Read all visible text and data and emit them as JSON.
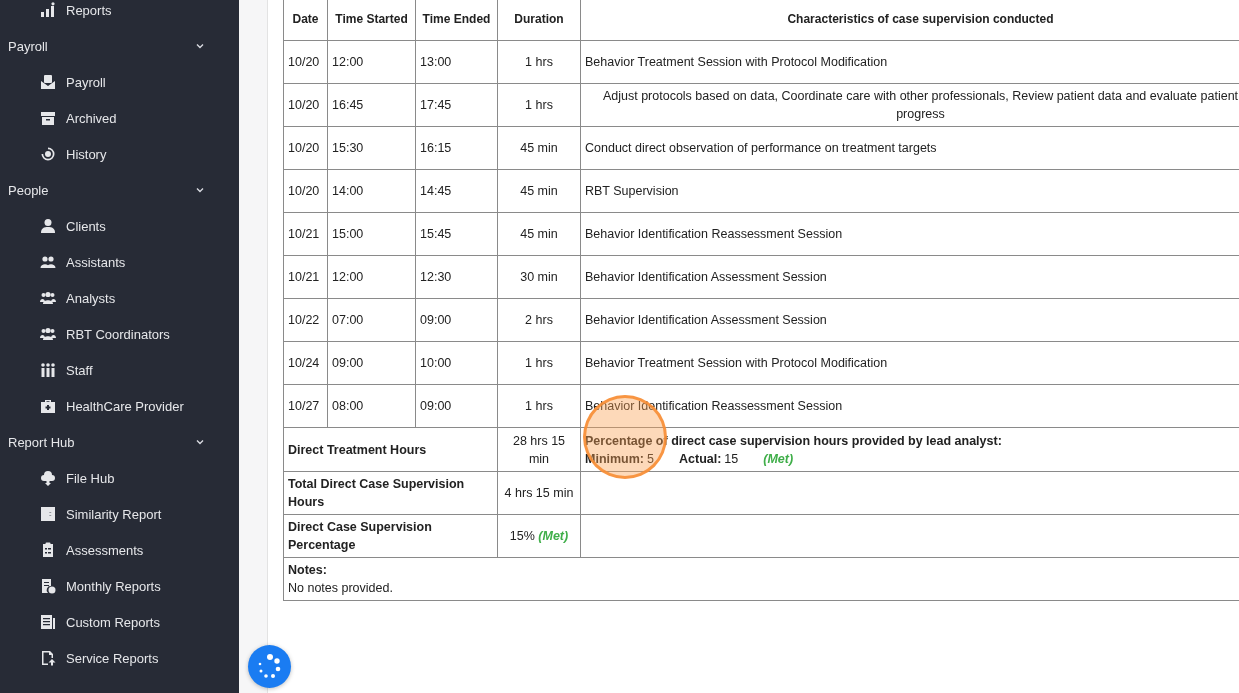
{
  "sidebar": {
    "sections": [
      {
        "items": [
          {
            "label": "Reports"
          }
        ]
      },
      {
        "title": "Payroll",
        "expanded": true,
        "items": [
          {
            "label": "Payroll"
          },
          {
            "label": "Archived"
          },
          {
            "label": "History"
          }
        ]
      },
      {
        "title": "People",
        "expanded": true,
        "items": [
          {
            "label": "Clients"
          },
          {
            "label": "Assistants"
          },
          {
            "label": "Analysts"
          },
          {
            "label": "RBT Coordinators"
          },
          {
            "label": "Staff"
          },
          {
            "label": "HealthCare Provider"
          }
        ]
      },
      {
        "title": "Report Hub",
        "expanded": true,
        "items": [
          {
            "label": "File Hub"
          },
          {
            "label": "Similarity Report"
          },
          {
            "label": "Assessments"
          },
          {
            "label": "Monthly Reports"
          },
          {
            "label": "Custom Reports"
          },
          {
            "label": "Service Reports"
          }
        ]
      }
    ]
  },
  "table": {
    "columns": [
      "Date",
      "Time Started",
      "Time Ended",
      "Duration",
      "Characteristics of case supervision conducted"
    ],
    "rows": [
      {
        "date": "10/20",
        "started": "12:00",
        "ended": "13:00",
        "duration": "1 hrs",
        "characteristics": "Behavior Treatment Session with Protocol Modification",
        "centered": false
      },
      {
        "date": "10/20",
        "started": "16:45",
        "ended": "17:45",
        "duration": "1 hrs",
        "characteristics": "Adjust protocols based on data, Coordinate care with other professionals, Review patient data and evaluate patient progress",
        "centered": true
      },
      {
        "date": "10/20",
        "started": "15:30",
        "ended": "16:15",
        "duration": "45 min",
        "characteristics": "Conduct direct observation of performance on treatment targets",
        "centered": false
      },
      {
        "date": "10/20",
        "started": "14:00",
        "ended": "14:45",
        "duration": "45 min",
        "characteristics": "RBT Supervision",
        "centered": false
      },
      {
        "date": "10/21",
        "started": "15:00",
        "ended": "15:45",
        "duration": "45 min",
        "characteristics": "Behavior Identification Reassessment Session",
        "centered": false
      },
      {
        "date": "10/21",
        "started": "12:00",
        "ended": "12:30",
        "duration": "30 min",
        "characteristics": "Behavior Identification Assessment Session",
        "centered": false
      },
      {
        "date": "10/22",
        "started": "07:00",
        "ended": "09:00",
        "duration": "2 hrs",
        "characteristics": "Behavior Identification Assessment Session",
        "centered": false
      },
      {
        "date": "10/24",
        "started": "09:00",
        "ended": "10:00",
        "duration": "1 hrs",
        "characteristics": "Behavior Treatment Session with Protocol Modification",
        "centered": false
      },
      {
        "date": "10/27",
        "started": "08:00",
        "ended": "09:00",
        "duration": "1 hrs",
        "characteristics": "Behavior Identification Reassessment Session",
        "centered": false
      }
    ],
    "summary": [
      {
        "label": "Direct Treatment Hours",
        "value": "28 hrs 15 min"
      },
      {
        "label": "Total Direct Case Supervision Hours",
        "value": "4 hrs 15 min"
      },
      {
        "label": "Direct Case Supervision Percentage",
        "value": "15%",
        "status": "(Met)"
      }
    ],
    "criteria": {
      "title": "Percentage of direct case supervision hours provided by lead analyst:",
      "minimum_label": "Minimum:",
      "minimum": "5",
      "actual_label": "Actual:",
      "actual": "15",
      "status": "(Met)"
    },
    "notes": {
      "label": "Notes:",
      "text": "No notes provided."
    }
  }
}
